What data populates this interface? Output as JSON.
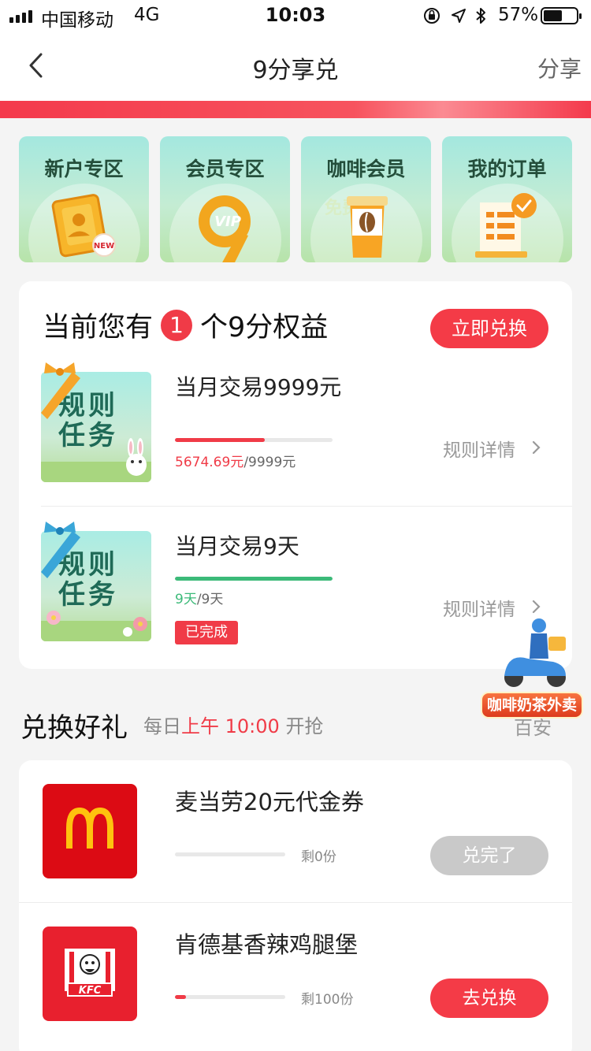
{
  "status_bar": {
    "carrier": "中国移动",
    "network": "4G",
    "time": "10:03",
    "battery_pct": "57%",
    "battery_level": 0.57,
    "icons": [
      "signal-icon",
      "orientation-lock-icon",
      "location-icon",
      "bluetooth-icon",
      "battery-icon"
    ]
  },
  "nav": {
    "back_icon": "chevron-left-icon",
    "title": "9分享兑",
    "share_label": "分享"
  },
  "categories": [
    {
      "label": "新户专区",
      "icon": "new-user-card-icon"
    },
    {
      "label": "会员专区",
      "icon": "vip-badge-icon"
    },
    {
      "label": "咖啡会员",
      "icon": "coffee-cup-icon",
      "watermark": "免费送"
    },
    {
      "label": "我的订单",
      "icon": "order-list-icon"
    }
  ],
  "rights": {
    "prefix": "当前您有",
    "count": "1",
    "suffix": "个9分权益",
    "redeem_now_label": "立即兑换",
    "tasks": [
      {
        "image_text": "规则任务",
        "bow_color": "#f6a52a",
        "title": "当月交易9999元",
        "progress": 0.568,
        "progress_color": "#f03b47",
        "progress_current": "5674.69元",
        "progress_total": "/9999元",
        "rule_link": "规则详情",
        "done_badge": ""
      },
      {
        "image_text": "规则任务",
        "bow_color": "#3aa6d8",
        "title": "当月交易9天",
        "progress": 1.0,
        "progress_color": "#3cba79",
        "progress_current": "9天",
        "progress_total": "/9天",
        "rule_link": "规则详情",
        "done_badge": "已完成"
      }
    ]
  },
  "floating_promo": {
    "label": "咖啡奶茶外卖",
    "icon": "delivery-scooter-icon"
  },
  "gifts": {
    "title": "兑换好礼",
    "sub_prefix": "每日",
    "sub_highlight": "上午 10:00",
    "sub_suffix": "开抢",
    "partial_hint": "百安",
    "items": [
      {
        "title": "麦当劳20元代金券",
        "logo": "mcdonalds-logo-icon",
        "logo_bg": "#e0101b",
        "remaining": "剩0份",
        "progress": 0.0,
        "button_label": "兑完了",
        "button_state": "disabled"
      },
      {
        "title": "肯德基香辣鸡腿堡",
        "logo": "kfc-logo-icon",
        "logo_bg": "#e8202e",
        "remaining": "剩100份",
        "progress": 0.1,
        "button_label": "去兑换",
        "button_state": "active"
      }
    ]
  },
  "colors": {
    "accent_red": "#f03b47",
    "success_green": "#3cba79",
    "tile_mint": "#a4e8df"
  }
}
